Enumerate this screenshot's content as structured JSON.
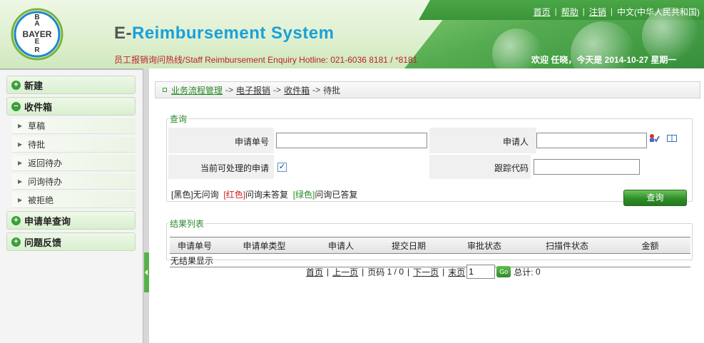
{
  "header": {
    "logo_text": "BAYER",
    "title_prefix": "E-",
    "title_rest": "Reimbursement System",
    "hotline": "员工报销询问热线/Staff Reimbursement Enquiry Hotline: 021-6036 8181 / *8181",
    "nav": [
      "首页",
      "帮助",
      "注销",
      "中文(中华人民共和国)"
    ],
    "welcome": "欢迎 任晓，今天是 2014-10-27 星期一"
  },
  "sidebar": {
    "groups": [
      {
        "label": "新建",
        "icon": "plus-icon"
      },
      {
        "label": "收件箱",
        "icon": "minus-icon"
      }
    ],
    "items": [
      "草稿",
      "待批",
      "返回待办",
      "问询待办",
      "被拒绝"
    ],
    "groups_after": [
      {
        "label": "申请单查询",
        "icon": "plus-icon"
      },
      {
        "label": "问题反馈",
        "icon": "plus-icon"
      }
    ]
  },
  "breadcrumb": {
    "items": [
      "业务流程管理",
      "电子报销",
      "收件箱"
    ],
    "current": "待批",
    "separator": "->"
  },
  "query": {
    "legend": "查询",
    "app_no_label": "申请单号",
    "app_no_value": "",
    "applicant_label": "申请人",
    "applicant_value": "",
    "current_label": "当前可处理的申请",
    "current_checked": true,
    "tracking_label": "跟踪代码",
    "tracking_value": "",
    "legend_black": "[黑色]",
    "legend_black_text": "无问询",
    "legend_red": "[红色]",
    "legend_red_text": "问询未答复",
    "legend_green": "[绿色]",
    "legend_green_text": "问询已答复",
    "query_button": "查询"
  },
  "results": {
    "legend": "结果列表",
    "columns": [
      "申请单号",
      "申请单类型",
      "申请人",
      "提交日期",
      "审批状态",
      "扫描件状态",
      "金额"
    ],
    "empty_text": "无结果显示"
  },
  "pager": {
    "first": "首页",
    "prev": "上一页",
    "page_label": "页码",
    "page_info": "1 / 0",
    "next": "下一页",
    "last": "末页",
    "page_input": "1",
    "go": "Go",
    "total_label": "总计:",
    "total": "0"
  },
  "colors": {
    "accent_green": "#3aa03a",
    "title_blue": "#1aa0d8",
    "hotline_red": "#c0202a"
  }
}
